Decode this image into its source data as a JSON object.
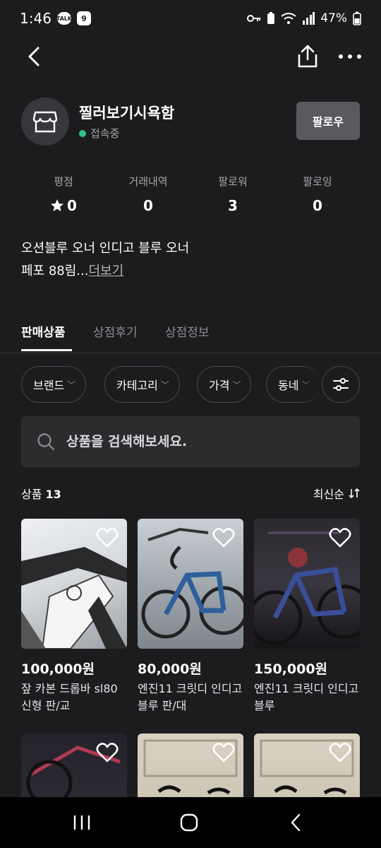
{
  "status_bar": {
    "time": "1:46",
    "talk_badge": "TALK",
    "loc_badge": "9",
    "battery": "47%"
  },
  "nav": {
    "back_icon": "back-icon",
    "share_icon": "share-icon",
    "more_icon": "more-icon"
  },
  "profile": {
    "name": "찔러보기시욕함",
    "status": "접속중",
    "status_color": "#2cc48a",
    "follow_label": "팔로우"
  },
  "stats": [
    {
      "label": "평점",
      "value": "0",
      "icon": "star-icon"
    },
    {
      "label": "거래내역",
      "value": "0"
    },
    {
      "label": "팔로워",
      "value": "3"
    },
    {
      "label": "팔로잉",
      "value": "0"
    }
  ],
  "bio": {
    "line1": "오션블루 오너 인디고 블루 오너",
    "line2": "페포 88림...",
    "more": "더보기"
  },
  "tabs": [
    {
      "label": "판매상품",
      "active": true
    },
    {
      "label": "상점후기",
      "active": false
    },
    {
      "label": "상점정보",
      "active": false
    }
  ],
  "filters": [
    {
      "label": "브랜드"
    },
    {
      "label": "카테고리"
    },
    {
      "label": "가격"
    },
    {
      "label": "동네"
    }
  ],
  "search": {
    "placeholder": "상품을 검색해보세요."
  },
  "listing": {
    "count_label": "상품",
    "count": "13",
    "sort_label": "최신순"
  },
  "products": [
    {
      "price": "100,000원",
      "title": "잪 카본 드롭바 sl80 신형 판/교"
    },
    {
      "price": "80,000원",
      "title": "엔진11 크릿디 인디고 블루 판/대"
    },
    {
      "price": "150,000원",
      "title": "엔진11 크릿디 인디고 블루"
    },
    {
      "price": "",
      "title": ""
    },
    {
      "price": "",
      "title": ""
    },
    {
      "price": "",
      "title": ""
    }
  ]
}
